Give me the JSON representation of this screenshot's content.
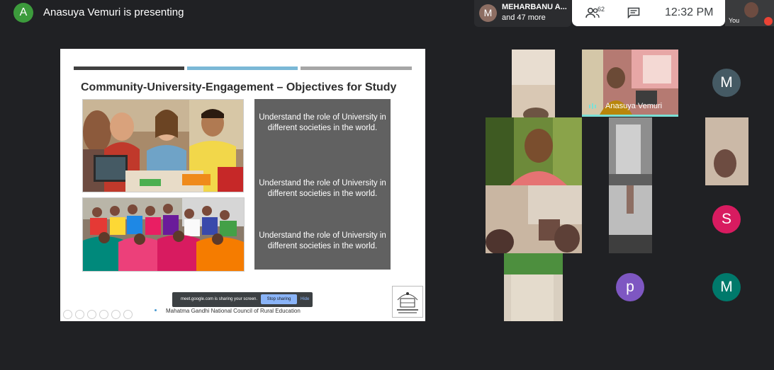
{
  "top_bar": {
    "presenter_initial": "A",
    "presenter_text": "Anasuya Vemuri is presenting",
    "participant_initial": "M",
    "participant_name": "MEHARBANU A...",
    "participant_more": "and 47 more",
    "people_count": "62",
    "time": "12:32 PM",
    "you_label": "You"
  },
  "slide": {
    "title": "Community-University-Engagement – Objectives for Study",
    "objectives": [
      "Understand the role of University in different societies in the world.",
      "Understand the role of University in different societies in the world.",
      "Understand the role of University in different societies in the world."
    ],
    "footer": "Mahatma Gandhi National Council of Rural Education",
    "share_text": "meet.google.com is sharing your screen.",
    "stop_sharing": "Stop sharing",
    "hide": "Hide",
    "bar_colors": [
      "#404040",
      "#7ab8d6",
      "#a6a6a6"
    ]
  },
  "tiles": {
    "speaker_name": "Anasuya Vemuri",
    "avatars": [
      {
        "initial": "M",
        "color": "#455a64"
      },
      {
        "initial": "S",
        "color": "#d81b60"
      },
      {
        "initial": "p",
        "color": "#7e57c2"
      },
      {
        "initial": "M",
        "color": "#00796b"
      }
    ]
  }
}
